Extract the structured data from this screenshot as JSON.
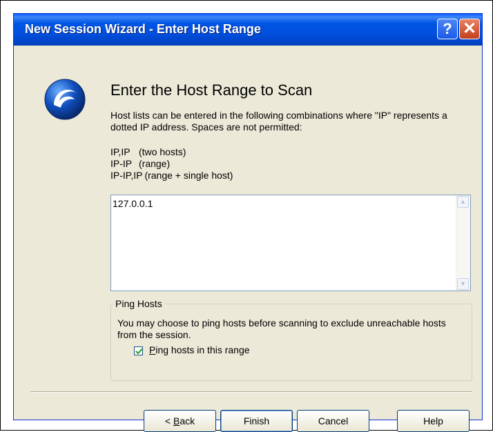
{
  "window": {
    "title": "New Session Wizard - Enter Host Range",
    "help_glyph": "?",
    "close_glyph": "✕"
  },
  "main": {
    "heading": "Enter the Host Range to Scan",
    "description": "Host lists can be entered in the following combinations where \"IP\" represents a dotted IP address.  Spaces are not permitted:",
    "combinations": [
      {
        "code": "IP,IP",
        "desc": "(two hosts)"
      },
      {
        "code": "IP-IP",
        "desc": "(range)"
      },
      {
        "code": "IP-IP,IP",
        "desc": "(range + single host)"
      }
    ],
    "host_list_value": "127.0.0.1"
  },
  "ping": {
    "group_title": "Ping Hosts",
    "description": "You may choose to ping hosts before scanning to exclude unreachable hosts from the session.",
    "checkbox_label_accel": "P",
    "checkbox_label_rest": "ing hosts in this range",
    "checked": true
  },
  "buttons": {
    "back_prefix": "< ",
    "back_accel": "B",
    "back_rest": "ack",
    "finish": "Finish",
    "cancel": "Cancel",
    "help": "Help"
  },
  "icons": {
    "app": "app-logo-icon",
    "scroll_up": "scroll-up-icon",
    "scroll_down": "scroll-down-icon",
    "check": "checkmark-icon"
  },
  "colors": {
    "titlebar": "#0054e3",
    "dialog_bg": "#ece9d8",
    "close_button": "#c3401c"
  }
}
